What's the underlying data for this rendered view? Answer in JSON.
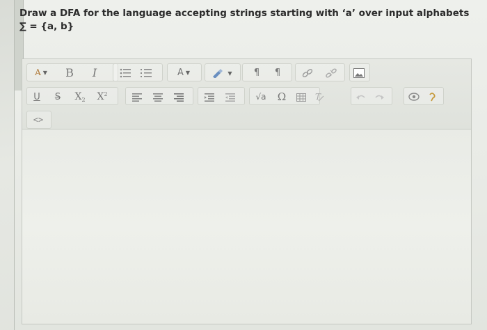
{
  "question": {
    "text": "Draw a DFA for the language accepting strings starting with ‘a’ over input alphabets ∑ = {a, b}"
  },
  "toolbar": {
    "row1": {
      "paragraph_style": "A",
      "bold": "B",
      "italic": "I",
      "font_color": "A",
      "pilcrow_ltr": "¶",
      "pilcrow_rtl": "¶"
    },
    "row2": {
      "underline": "U",
      "strike": "S",
      "subscript": "X",
      "superscript": "X",
      "sqrt": "√a",
      "omega": "Ω"
    },
    "row3": {
      "html": "<>"
    }
  }
}
